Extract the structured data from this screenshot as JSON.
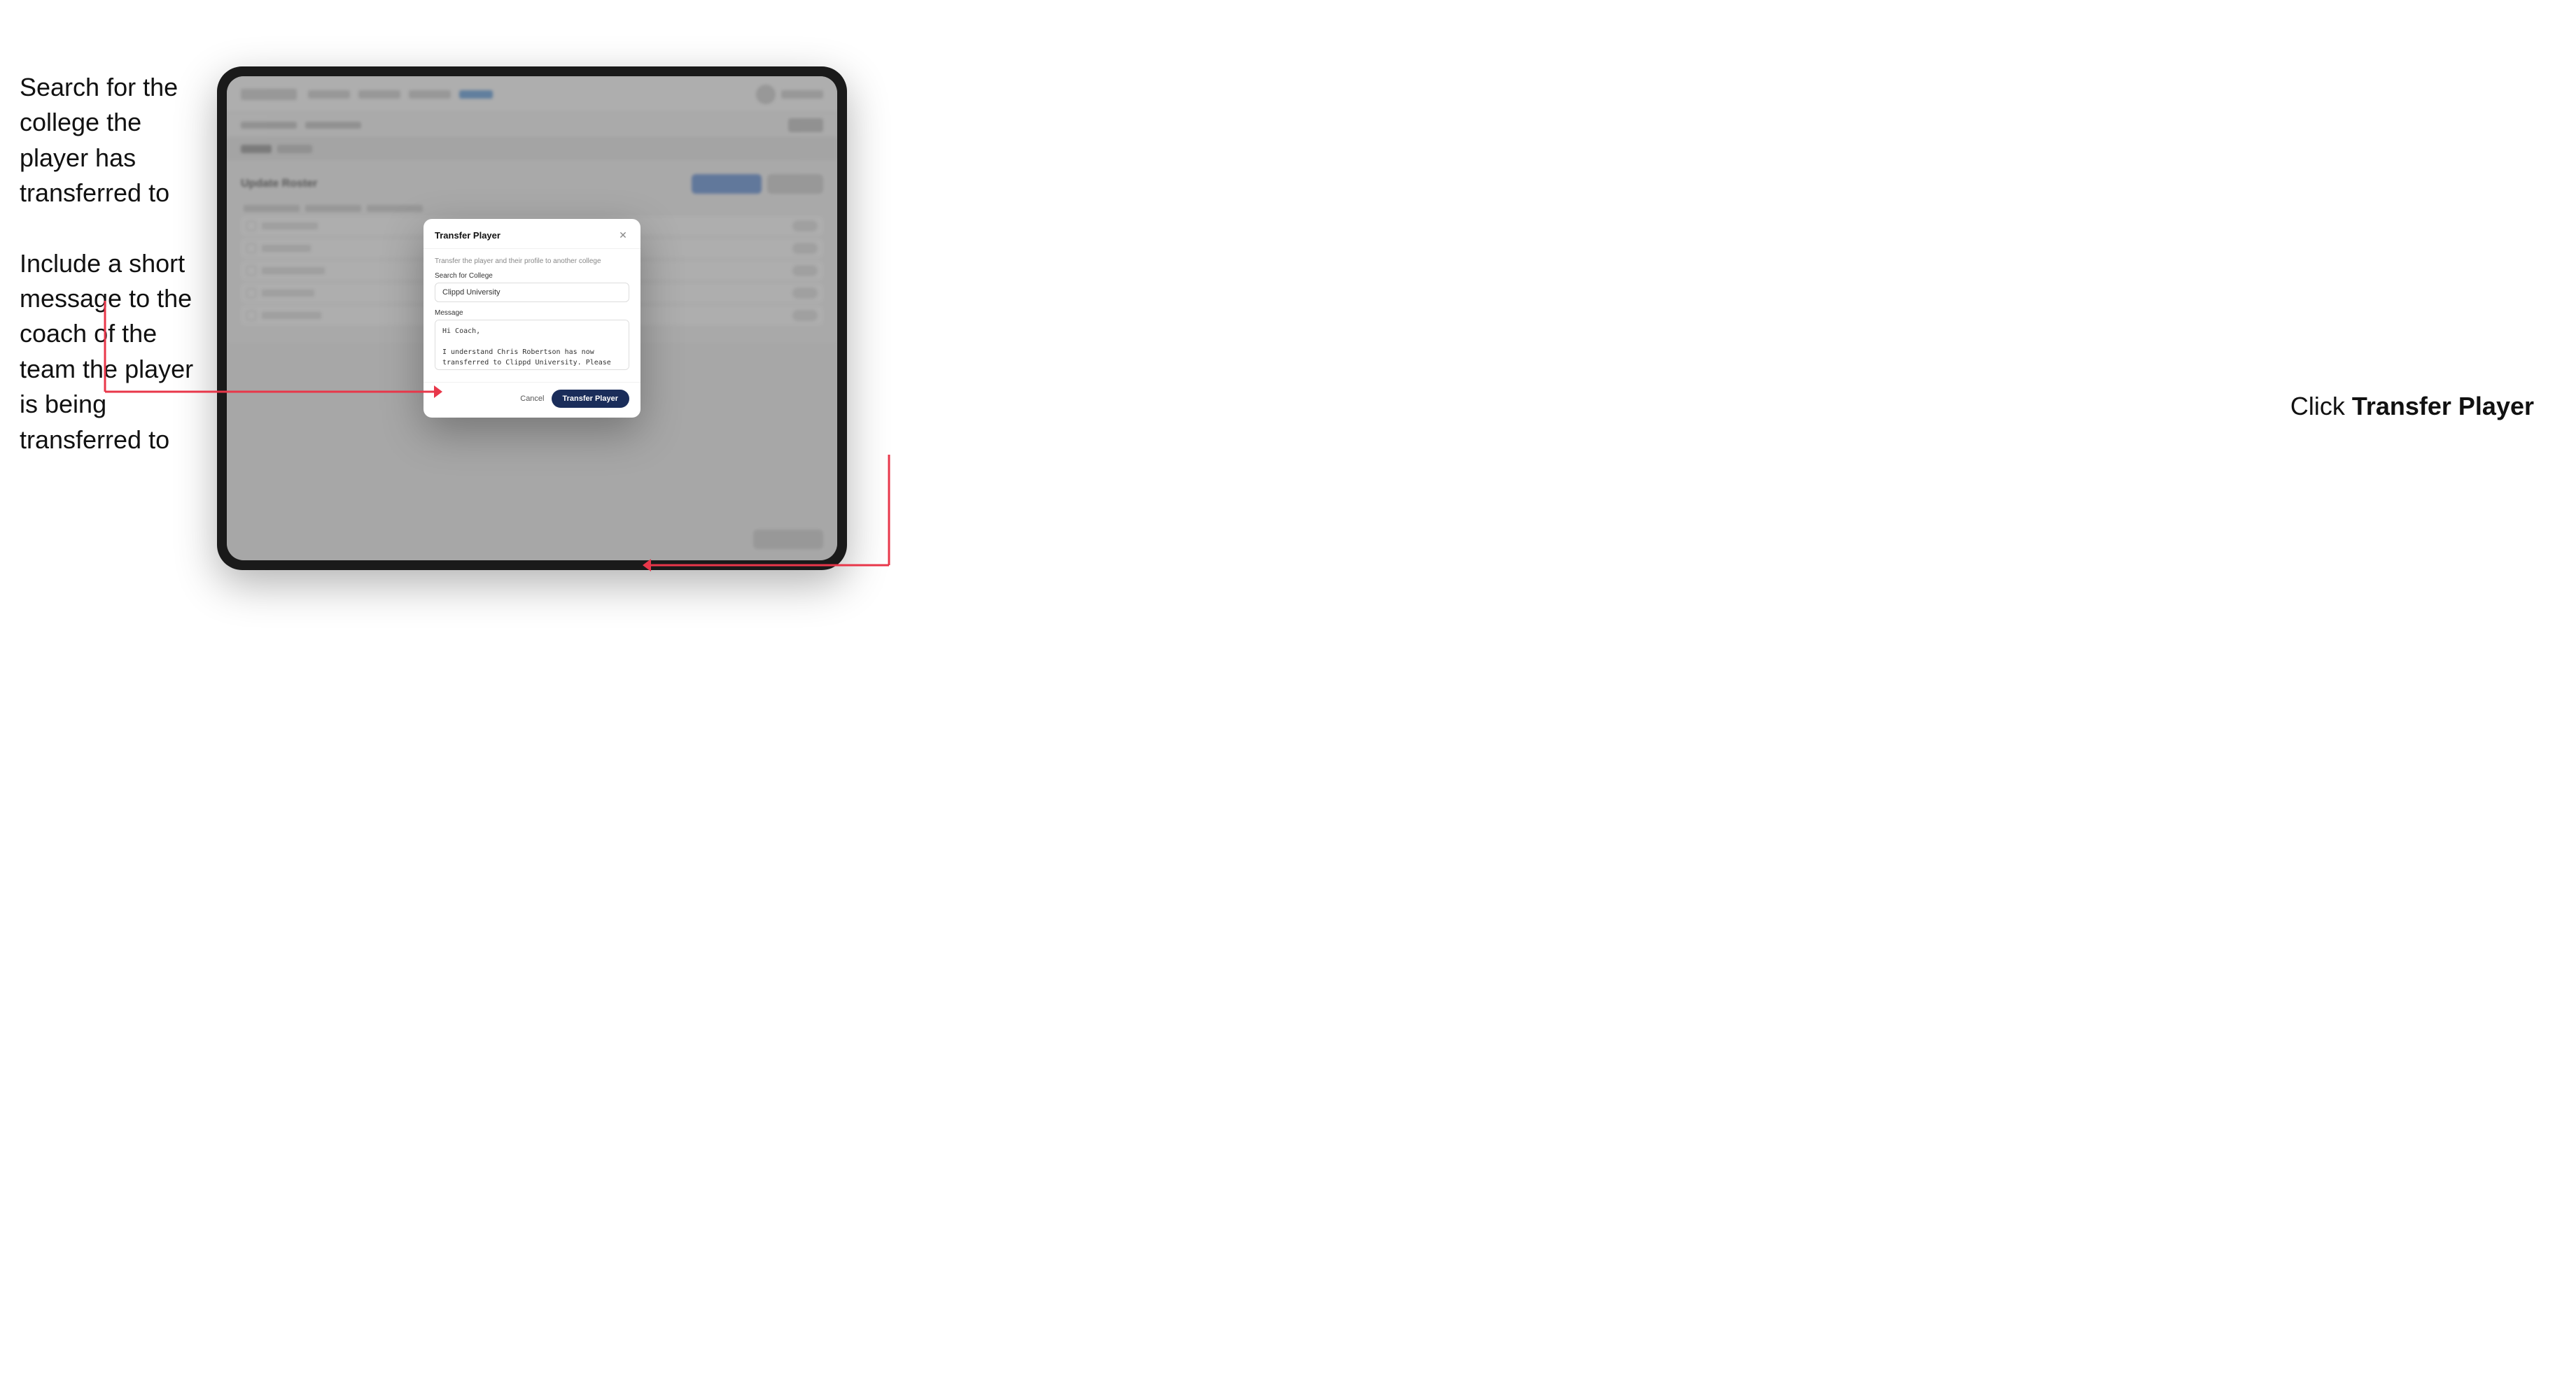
{
  "annotations": {
    "left_top": "Search for the college the player has transferred to",
    "left_bottom": "Include a short message to the coach of the team the player is being transferred to",
    "right": "Click ",
    "right_bold": "Transfer Player"
  },
  "tablet": {
    "nav": {
      "logo": "",
      "items": [
        "Community",
        "Tools",
        "Analytics",
        "Roster"
      ],
      "active_item": "Roster"
    },
    "page_title": "Update Roster",
    "modal": {
      "title": "Transfer Player",
      "subtitle": "Transfer the player and their profile to another college",
      "search_label": "Search for College",
      "search_value": "Clippd University",
      "message_label": "Message",
      "message_value": "Hi Coach,\n\nI understand Chris Robertson has now transferred to Clippd University. Please accept this transfer request when you can.",
      "cancel_label": "Cancel",
      "transfer_label": "Transfer Player"
    }
  }
}
